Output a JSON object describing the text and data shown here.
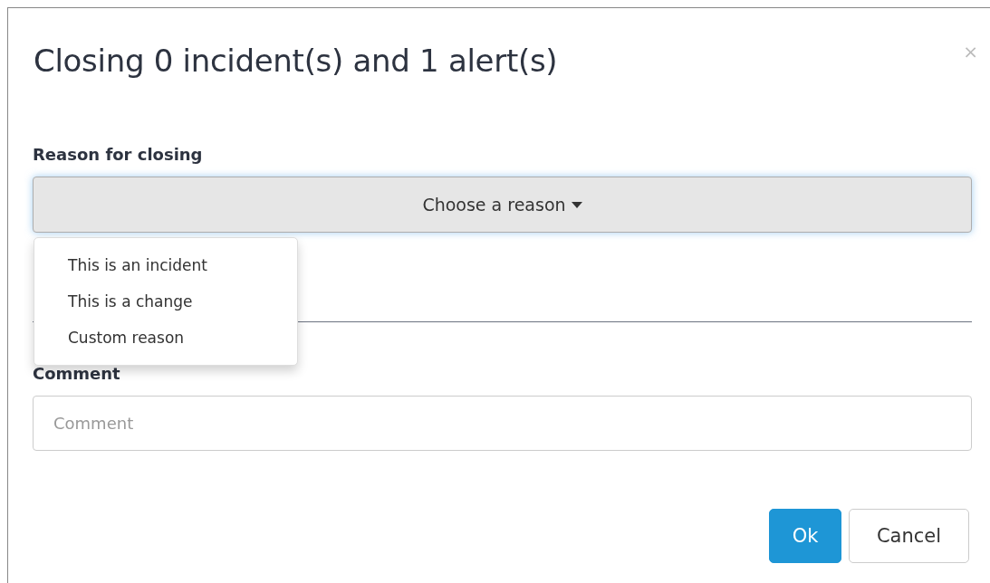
{
  "dialog": {
    "title": "Closing 0 incident(s) and 1 alert(s)",
    "close": "×"
  },
  "reason": {
    "label": "Reason for closing",
    "dropdown": {
      "text": "Choose a reason",
      "expanded": true,
      "options": [
        {
          "label": "This is an incident"
        },
        {
          "label": "This is a change"
        },
        {
          "label": "Custom reason"
        }
      ]
    }
  },
  "comment": {
    "label": "Comment",
    "placeholder": "Comment"
  },
  "buttons": [
    {
      "label": "Ok",
      "kind": "primary"
    },
    {
      "label": "Cancel",
      "kind": "default"
    }
  ]
}
